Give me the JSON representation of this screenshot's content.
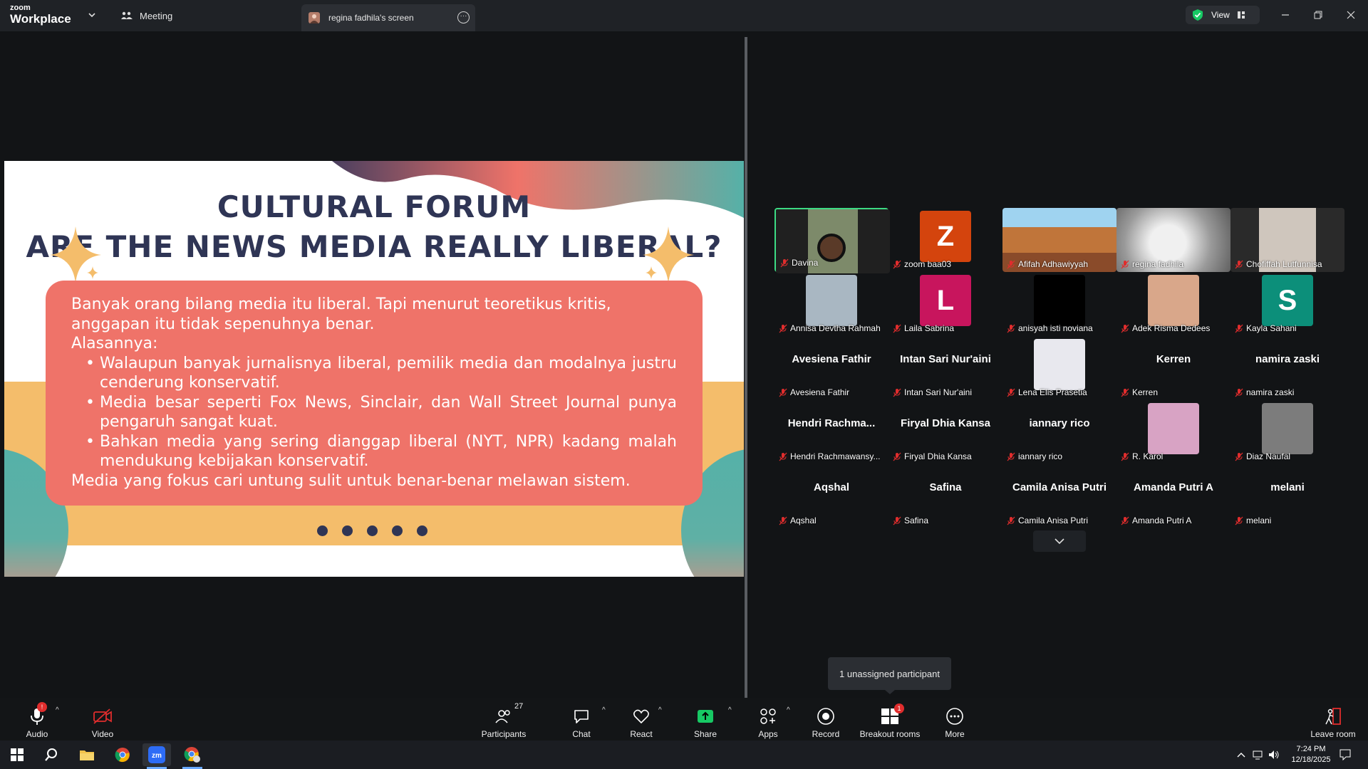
{
  "app": {
    "brand_top": "zoom",
    "brand_bottom": "Workplace",
    "meeting_tab": "Meeting",
    "share_tab": "regina fadhila's screen",
    "view_label": "View"
  },
  "slide": {
    "title_line1": "CULTURAL FORUM",
    "title_line2": "ARE THE NEWS MEDIA REALLY LIBERAL?",
    "intro": "Banyak orang bilang media itu liberal. Tapi menurut teoretikus kritis, anggapan itu tidak sepenuhnya benar.",
    "reasons_label": "Alasannya:",
    "bullets": [
      "Walaupun banyak jurnalisnya liberal, pemilik media dan modalnya justru cenderung konservatif.",
      "Media besar seperti Fox News, Sinclair, dan Wall Street Journal punya pengaruh sangat kuat.",
      "Bahkan media yang sering dianggap liberal (NYT, NPR) kadang malah mendukung kebijakan konservatif."
    ],
    "conclusion": "Media yang fokus cari untung sulit untuk benar-benar melawan sistem."
  },
  "participants": [
    {
      "name": "Davina",
      "type": "video",
      "active": true
    },
    {
      "name": "zoom baa03",
      "type": "avatar",
      "letter": "Z",
      "color": "#d4440d"
    },
    {
      "name": "Afifah Adhawiyyah",
      "type": "video"
    },
    {
      "name": "regina fadhila",
      "type": "video"
    },
    {
      "name": "Chofiffah Lutfunnisa",
      "type": "video"
    },
    {
      "name": "Annisa Devtha Rahmah",
      "type": "photo"
    },
    {
      "name": "Laila Sabrina",
      "type": "avatar",
      "letter": "L",
      "color": "#c8155d"
    },
    {
      "name": "anisyah isti noviana",
      "type": "photo"
    },
    {
      "name": "Adek Risma Dedees",
      "type": "photo"
    },
    {
      "name": "Kayla Sahani",
      "type": "avatar",
      "letter": "S",
      "color": "#0c8f7a"
    },
    {
      "name": "Avesiena Fathir",
      "type": "text",
      "display": "Avesiena Fathir"
    },
    {
      "name": "Intan Sari Nur'aini",
      "type": "text",
      "display": "Intan Sari Nur'aini"
    },
    {
      "name": "Lena Elis Prasetia",
      "type": "photo"
    },
    {
      "name": "Kerren",
      "type": "text",
      "display": "Kerren"
    },
    {
      "name": "namira zaski",
      "type": "text",
      "display": "namira zaski"
    },
    {
      "name": "Hendri Rachmawansy...",
      "type": "text",
      "display": "Hendri  Rachma..."
    },
    {
      "name": "Firyal Dhia Kansa",
      "type": "text",
      "display": "Firyal Dhia Kansa"
    },
    {
      "name": "iannary rico",
      "type": "text",
      "display": "iannary rico"
    },
    {
      "name": "R. Karol",
      "type": "photo"
    },
    {
      "name": "Diaz Naufal",
      "type": "photo"
    },
    {
      "name": "Aqshal",
      "type": "text",
      "display": "Aqshal"
    },
    {
      "name": "Safina",
      "type": "text",
      "display": "Safina"
    },
    {
      "name": "Camila Anisa Putri",
      "type": "text",
      "display": "Camila Anisa Putri"
    },
    {
      "name": "Amanda Putri A",
      "type": "text",
      "display": "Amanda Putri A"
    },
    {
      "name": "melani",
      "type": "text",
      "display": "melani"
    }
  ],
  "unassigned": "1 unassigned participant",
  "toolbar": {
    "audio": "Audio",
    "audio_badge": "!",
    "video": "Video",
    "participants": "Participants",
    "participants_count": "27",
    "chat": "Chat",
    "react": "React",
    "share": "Share",
    "apps": "Apps",
    "record": "Record",
    "breakout": "Breakout rooms",
    "breakout_badge": "1",
    "more": "More",
    "leave": "Leave room"
  },
  "taskbar": {
    "time": "7:24 PM",
    "date": "12/18/2025"
  },
  "colors": {
    "accent_green": "#17c964",
    "active_border": "#3ddc84",
    "slide_card": "#ef7369",
    "slide_title": "#2f3555",
    "slide_orange": "#f4bd6b",
    "slide_teal": "#55b1a8"
  }
}
